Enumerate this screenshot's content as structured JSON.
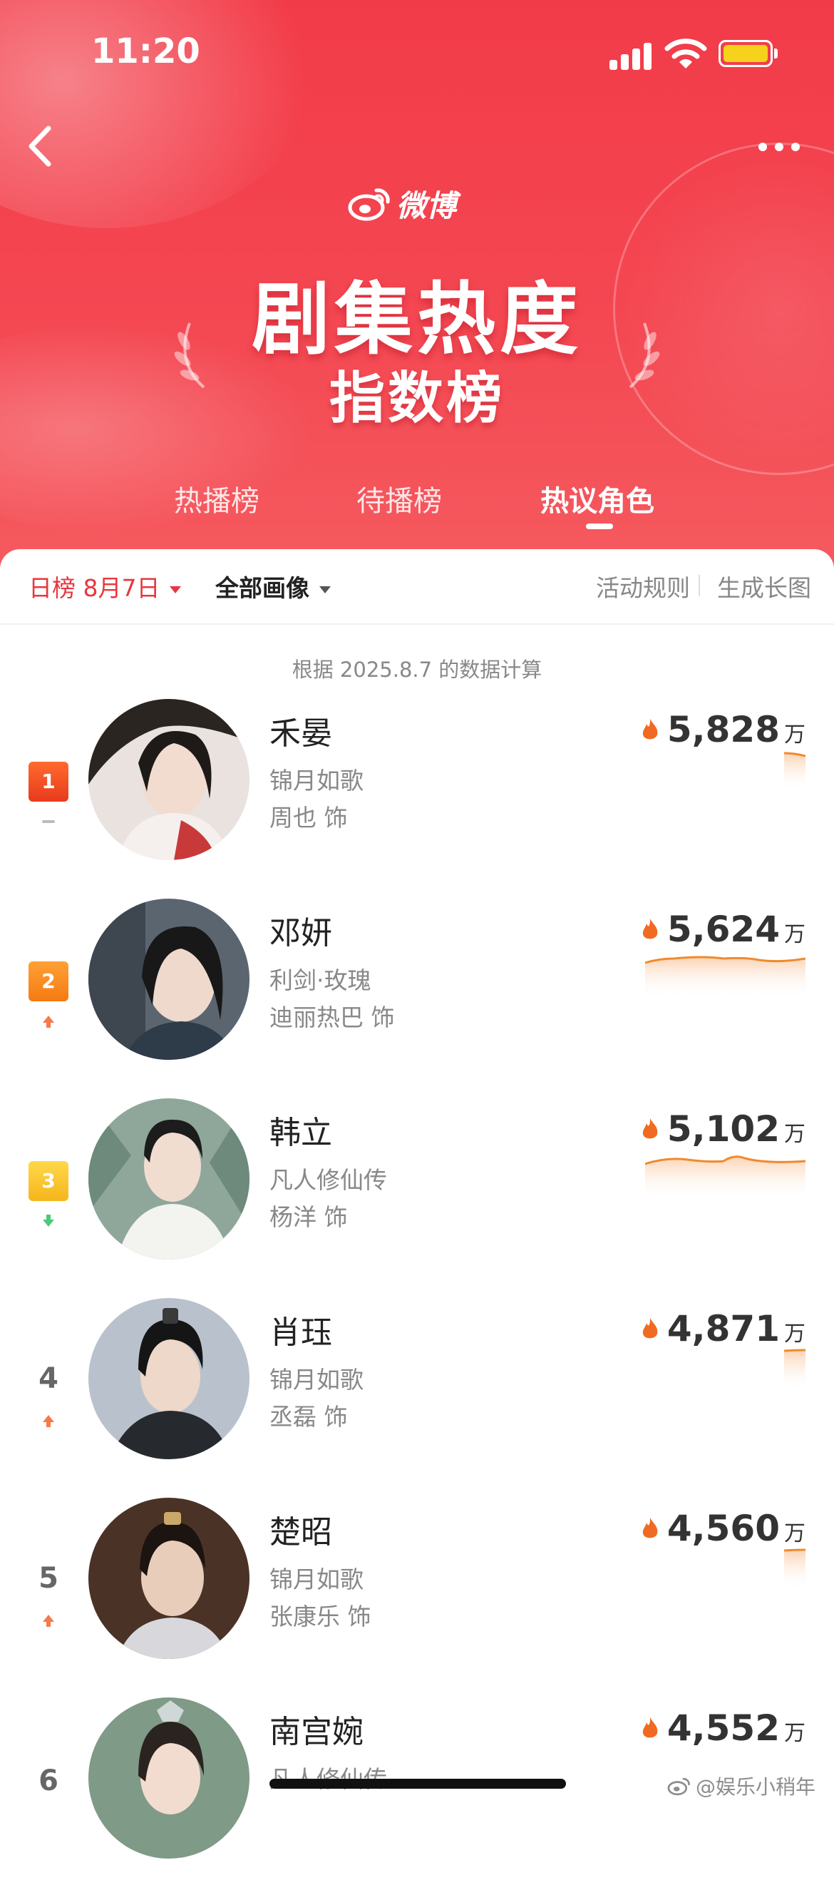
{
  "status_bar": {
    "time": "11:20"
  },
  "header": {
    "brand": "微博",
    "title_line1": "剧集热度",
    "title_line2": "指数榜",
    "tabs": [
      {
        "label": "热播榜",
        "active": false
      },
      {
        "label": "待播榜",
        "active": false
      },
      {
        "label": "热议角色",
        "active": true
      }
    ]
  },
  "filters": {
    "period": "日榜 8月7日",
    "segment": "全部画像",
    "rules_link": "活动规则",
    "long_image_link": "生成长图"
  },
  "calc_note": "根据 2025.8.7 的数据计算",
  "colors": {
    "brand_red": "#f23b48",
    "accent_orange": "#f08a2c",
    "trend_up": "#f47a4a",
    "trend_down": "#4cc879"
  },
  "rankings": [
    {
      "rank": "1",
      "trend": "same",
      "name": "禾晏",
      "drama": "锦月如歌",
      "actor": "周也 饰",
      "heat": "5,828",
      "unit": "万"
    },
    {
      "rank": "2",
      "trend": "up",
      "name": "邓妍",
      "drama": "利剑·玫瑰",
      "actor": "迪丽热巴 饰",
      "heat": "5,624",
      "unit": "万"
    },
    {
      "rank": "3",
      "trend": "down",
      "name": "韩立",
      "drama": "凡人修仙传",
      "actor": "杨洋 饰",
      "heat": "5,102",
      "unit": "万"
    },
    {
      "rank": "4",
      "trend": "up",
      "name": "肖珏",
      "drama": "锦月如歌",
      "actor": "丞磊 饰",
      "heat": "4,871",
      "unit": "万"
    },
    {
      "rank": "5",
      "trend": "up",
      "name": "楚昭",
      "drama": "锦月如歌",
      "actor": "张康乐 饰",
      "heat": "4,560",
      "unit": "万"
    },
    {
      "rank": "6",
      "trend": "",
      "name": "南宫婉",
      "drama": "凡人修仙传",
      "actor": "",
      "heat": "4,552",
      "unit": "万"
    }
  ],
  "watermark": "@娱乐小稍年"
}
